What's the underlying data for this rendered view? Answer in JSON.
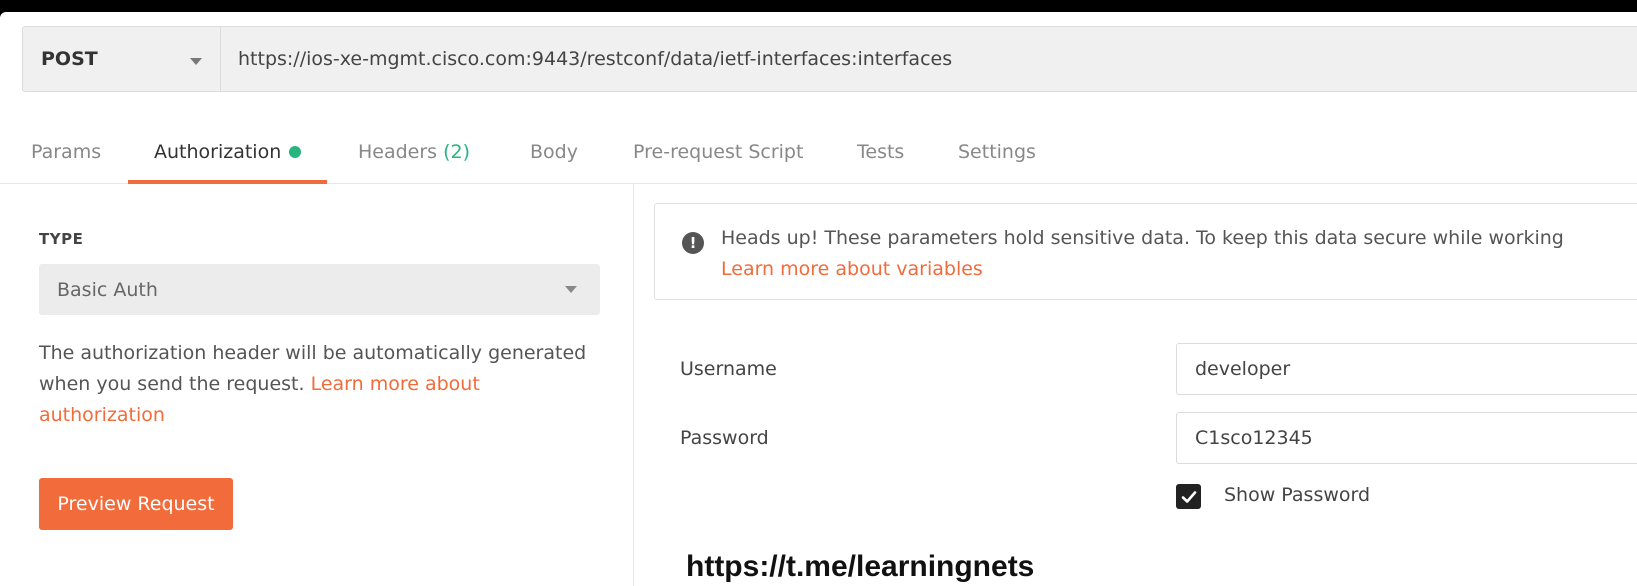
{
  "request": {
    "method": "POST",
    "url": "https://ios-xe-mgmt.cisco.com:9443/restconf/data/ietf-interfaces:interfaces"
  },
  "tabs": [
    {
      "label": "Params"
    },
    {
      "label": "Authorization"
    },
    {
      "label": "Headers",
      "count": "(2)"
    },
    {
      "label": "Body"
    },
    {
      "label": "Pre-request Script"
    },
    {
      "label": "Tests"
    },
    {
      "label": "Settings"
    }
  ],
  "auth": {
    "type_label": "TYPE",
    "type_value": "Basic Auth",
    "description": "The authorization header will be automatically generated when you send the request. ",
    "description_link": "Learn more about authorization",
    "preview_button": "Preview Request"
  },
  "notice": {
    "text": "Heads up! These parameters hold sensitive data. To keep this data secure while working",
    "link": "Learn more about variables"
  },
  "fields": {
    "username_label": "Username",
    "username_value": "developer",
    "password_label": "Password",
    "password_value": "C1sco12345",
    "show_password_label": "Show Password"
  },
  "watermark": "https://t.me/learningnets",
  "colors": {
    "accent": "#f26b3a",
    "active_dot": "#26b47f"
  }
}
